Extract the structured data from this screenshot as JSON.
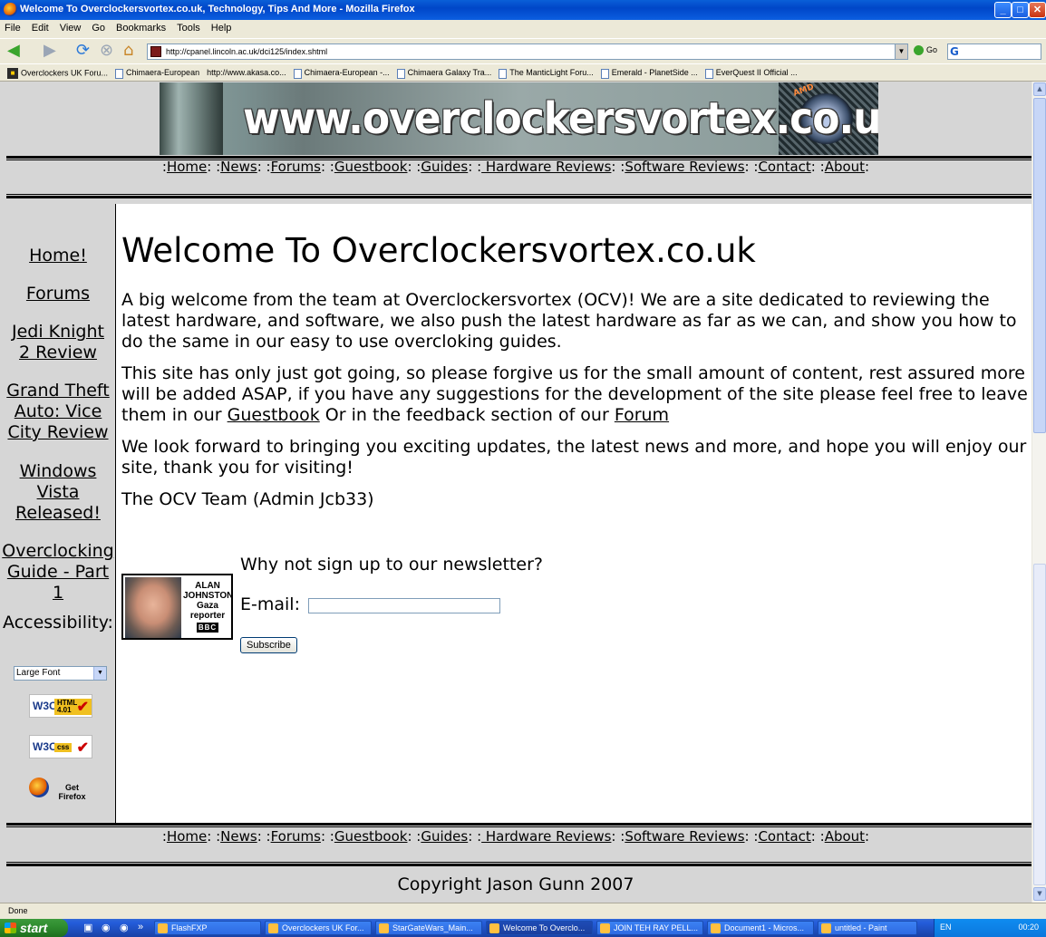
{
  "window": {
    "title": "Welcome To Overclockersvortex.co.uk, Technology, Tips And More - Mozilla Firefox",
    "minimize": "_",
    "maximize": "□",
    "close": "✕"
  },
  "menu": [
    "File",
    "Edit",
    "View",
    "Go",
    "Bookmarks",
    "Tools",
    "Help"
  ],
  "toolbar": {
    "url": "http://cpanel.lincoln.ac.uk/dci125/index.shtml",
    "go_label": "Go",
    "search_engine": "G"
  },
  "bookmarks": [
    {
      "label": "Overclockers UK Foru...",
      "icon": "ocuk"
    },
    {
      "label": "Chimaera-European",
      "icon": "page"
    },
    {
      "label": "http://www.akasa.co...",
      "icon": "none"
    },
    {
      "label": "Chimaera-European -...",
      "icon": "page"
    },
    {
      "label": "Chimaera Galaxy Tra...",
      "icon": "page"
    },
    {
      "label": "The ManticLight Foru...",
      "icon": "page"
    },
    {
      "label": "Emerald - PlanetSide ...",
      "icon": "page"
    },
    {
      "label": "EverQuest II Official ...",
      "icon": "page"
    }
  ],
  "page": {
    "banner_text": "www.overclockersvortex.co.uk",
    "banner_chip": "AMD",
    "nav": [
      "Home",
      "News",
      "Forums",
      "Guestbook",
      "Guides",
      " Hardware Reviews",
      "Software Reviews",
      "Contact",
      "About"
    ],
    "sidebar": {
      "home": "Home!",
      "forums": "Forums",
      "jedi": [
        "Jedi Knight",
        "2 Review"
      ],
      "gta": [
        "Grand Theft",
        "Auto: Vice",
        "City Review"
      ],
      "vista": [
        "Windows",
        "Vista",
        "Released!"
      ],
      "oc": [
        "Overclocking",
        "Guide - Part",
        "1"
      ],
      "accessibility": "Accessibility:",
      "font_select": "Large Font",
      "w3c": "W3C",
      "html_badge": "HTML 4.01",
      "css_badge": "css",
      "get_firefox": "Get Firefox"
    },
    "heading": "Welcome To Overclockersvortex.co.uk",
    "para1": "A big welcome from the team at Overclockersvortex (OCV)! We are a site dedicated to reviewing the latest hardware, and software, we also push the latest hardware as far as we can, and show you how to do the same in our easy to use overcloking guides.",
    "para2_pre": "This site has only just got going, so please forgive us for the small amount of content, rest assured more will be added ASAP, if you have any suggestions for the development of the site please feel free to leave them in our ",
    "para2_link1": "Guestbook",
    "para2_mid": " Or in the feedback section of our ",
    "para2_link2": "Forum",
    "para3": "We look forward to bringing you exciting updates, the latest news and more, and hope you will enjoy our site, thank you for visiting!",
    "signoff": "The OCV Team (Admin Jcb33)",
    "reporter": {
      "name1": "ALAN",
      "name2": "JOHNSTON",
      "role1": "Gaza",
      "role2": "reporter",
      "org": "BBC"
    },
    "newsletter": {
      "question": "Why not sign up to our newsletter?",
      "email_label": "E-mail:",
      "button": "Subscribe"
    },
    "copyright": "Copyright Jason Gunn 2007"
  },
  "status": "Done",
  "taskbar": {
    "start": "start",
    "tasks": [
      {
        "label": "FlashFXP"
      },
      {
        "label": "Overclockers UK For..."
      },
      {
        "label": "StarGateWars_Main..."
      },
      {
        "label": "Welcome To Overclo...",
        "active": true
      },
      {
        "label": "JOIN TEH RAY PELL..."
      },
      {
        "label": "Document1 - Micros..."
      },
      {
        "label": "untitled - Paint"
      }
    ],
    "lang": "EN",
    "clock": "00:20"
  }
}
